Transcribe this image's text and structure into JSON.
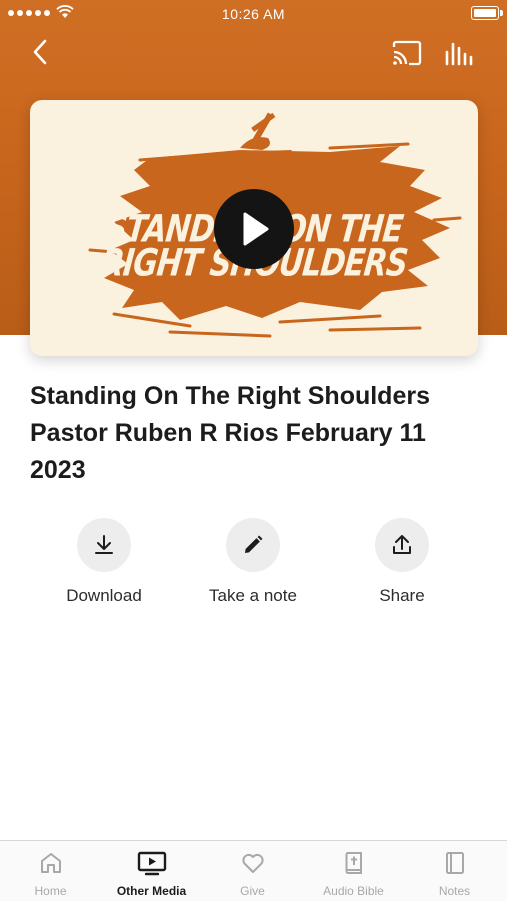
{
  "status_bar": {
    "time": "10:26 AM"
  },
  "sermon": {
    "artwork": {
      "line1": "STANDING ON THE",
      "line2": "RIGHT SHOULDERS"
    },
    "title": "Standing On The Right Shoulders Pastor Ruben R Rios February 11 2023"
  },
  "actions": [
    {
      "label": "Download",
      "icon": "download-icon"
    },
    {
      "label": "Take a note",
      "icon": "pencil-icon"
    },
    {
      "label": "Share",
      "icon": "share-icon"
    }
  ],
  "tabs": [
    {
      "label": "Home",
      "icon": "home-icon",
      "active": false
    },
    {
      "label": "Other Media",
      "icon": "tv-play-icon",
      "active": true
    },
    {
      "label": "Give",
      "icon": "heart-icon",
      "active": false
    },
    {
      "label": "Audio Bible",
      "icon": "bible-icon",
      "active": false
    },
    {
      "label": "Notes",
      "icon": "notes-icon",
      "active": false
    }
  ],
  "colors": {
    "brand_orange": "#c9661d",
    "artwork_bg": "#fbf1df",
    "active_tab": "#1c1c1e",
    "inactive_tab": "#a8a8a8"
  }
}
